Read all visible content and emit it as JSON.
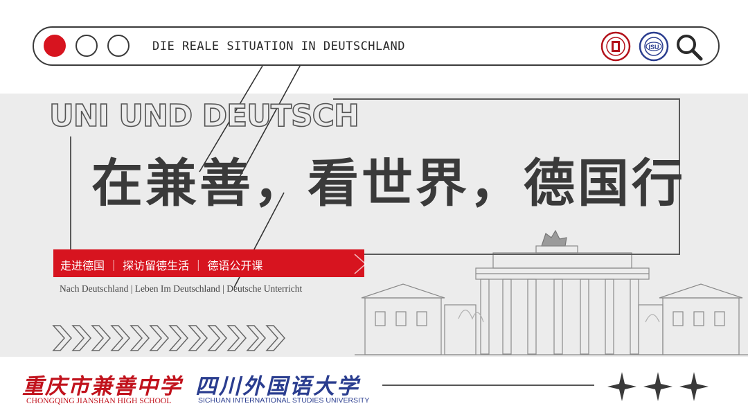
{
  "header": {
    "title": "DIE REALE SITUATION IN DEUTSCHLAND",
    "seal_1_text": "重庆市兼善中学 JIANSHAN HIGH SCHOOL",
    "seal_2_text": "四川外国语大学 SISU",
    "accent_color": "#d7141f"
  },
  "hero": {
    "outline_title": "UNI UND DEUTSCH",
    "main_title": "在兼善，看世界，德国行",
    "tagline_cn": "走进德国 ｜ 探访留德生活 ｜ 德语公开课",
    "tagline_de": "Nach Deutschland | Leben Im Deutschland | Deutsche Unterricht"
  },
  "footer": {
    "school_cn": "重庆市兼善中学",
    "school_en": "CHONGQING JIANSHAN HIGH SCHOOL",
    "uni_cn": "四川外国语大学",
    "uni_en": "SICHUAN INTERNATIONAL STUDIES UNIVERSITY",
    "school_color": "#c1121c",
    "uni_color": "#2a3d8f"
  }
}
